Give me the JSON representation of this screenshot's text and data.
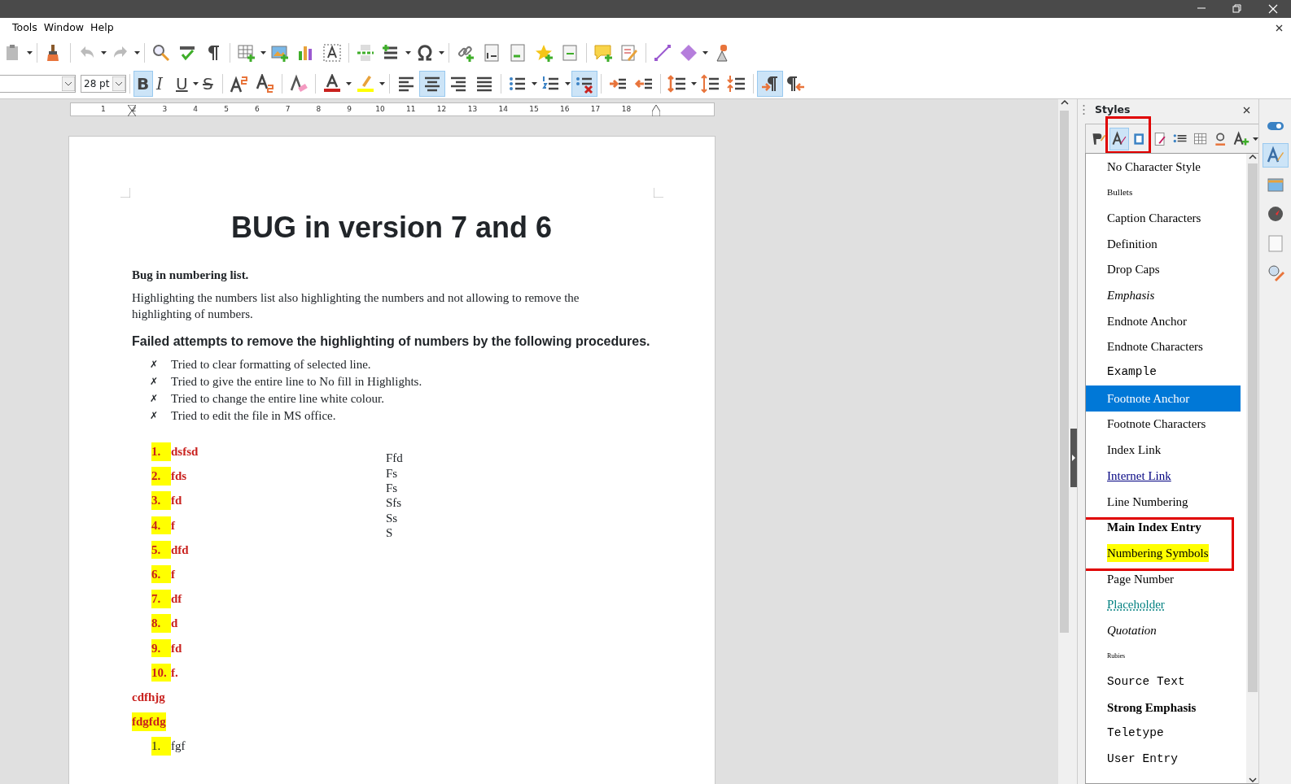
{
  "menu": [
    {
      "label": "Tools"
    },
    {
      "label": "Window"
    },
    {
      "label": "Help"
    }
  ],
  "formatting_toolbar": {
    "font_size": "28 pt",
    "toggles": [
      {
        "glyph": "B",
        "selected": true
      },
      {
        "glyph": "I",
        "selected": false
      },
      {
        "glyph": "U",
        "selected": false
      },
      {
        "glyph": "S",
        "selected": false
      }
    ],
    "alignment": [
      {
        "selected": false
      },
      {
        "selected": true
      },
      {
        "selected": false
      },
      {
        "selected": false
      }
    ],
    "lists": [
      {
        "selected": false
      },
      {
        "selected": false
      },
      {
        "selected": true
      }
    ],
    "direction": [
      {
        "selected": true
      },
      {
        "selected": false
      }
    ]
  },
  "ruler": {
    "numbers": [
      "1",
      "2",
      "3",
      "4",
      "5",
      "6",
      "7",
      "8",
      "9",
      "10",
      "11",
      "12",
      "13",
      "14",
      "15",
      "16",
      "17",
      "18"
    ]
  },
  "document": {
    "title": "BUG in version 7 and 6",
    "subtitle": "Bug in numbering list.",
    "paragraph": "Highlighting the numbers list also highlighting the numbers and not allowing to remove the highlighting of numbers.",
    "heading": "Failed attempts to remove the highlighting of numbers by the following procedures.",
    "bullets": [
      {
        "marker": "✗",
        "text": "Tried to clear formatting of selected line."
      },
      {
        "marker": "✗",
        "text": "Tried to give the entire line to No fill in Highlights."
      },
      {
        "marker": "✗",
        "text": "Tried to change the entire line white colour."
      },
      {
        "marker": "✗",
        "text": "Tried to edit the file in MS office."
      }
    ],
    "numbered": [
      {
        "number": "1.",
        "text": "dsfsd"
      },
      {
        "number": "2.",
        "text": "fds"
      },
      {
        "number": "3.",
        "text": "fd"
      },
      {
        "number": "4.",
        "text": "f"
      },
      {
        "number": "5.",
        "text": "dfd"
      },
      {
        "number": "6.",
        "text": "f"
      },
      {
        "number": "7.",
        "text": "df"
      },
      {
        "number": "8.",
        "text": "d"
      },
      {
        "number": "9.",
        "text": "fd"
      },
      {
        "number": "10.",
        "text": "f."
      }
    ],
    "frame_lines": [
      "Ffd",
      "Fs",
      "Fs",
      "Sfs",
      "Ss",
      "S"
    ],
    "after": [
      {
        "text": "cdfhjg",
        "highlighted": false
      },
      {
        "text": "fdgfdg",
        "highlighted": true
      }
    ],
    "second_list": [
      {
        "number": "1.",
        "text": "fgf"
      }
    ]
  },
  "sidebar": {
    "title": "Styles",
    "families": [
      {
        "selected": false
      },
      {
        "selected": true
      },
      {
        "selected": false
      },
      {
        "selected": false
      },
      {
        "selected": false
      },
      {
        "selected": false
      },
      {
        "selected": false
      },
      {
        "selected": false
      }
    ],
    "styles": [
      {
        "label": "No Character Style",
        "kind": "plain",
        "selected": false
      },
      {
        "label": "Bullets",
        "kind": "small",
        "selected": false
      },
      {
        "label": "Caption Characters",
        "kind": "plain",
        "selected": false
      },
      {
        "label": "Definition",
        "kind": "plain",
        "selected": false
      },
      {
        "label": "Drop Caps",
        "kind": "plain",
        "selected": false
      },
      {
        "label": "Emphasis",
        "kind": "italic",
        "selected": false
      },
      {
        "label": "Endnote Anchor",
        "kind": "plain",
        "selected": false
      },
      {
        "label": "Endnote Characters",
        "kind": "plain",
        "selected": false
      },
      {
        "label": "Example",
        "kind": "mono",
        "selected": false
      },
      {
        "label": "Footnote Anchor",
        "kind": "plain",
        "selected": true
      },
      {
        "label": "Footnote Characters",
        "kind": "plain",
        "selected": false
      },
      {
        "label": "Index Link",
        "kind": "plain",
        "selected": false
      },
      {
        "label": "Internet Link",
        "kind": "link",
        "selected": false
      },
      {
        "label": "Line Numbering",
        "kind": "plain",
        "selected": false
      },
      {
        "label": "Main Index Entry",
        "kind": "bold",
        "selected": false
      },
      {
        "label": "Numbering Symbols",
        "kind": "highlight",
        "selected": false
      },
      {
        "label": "Page Number",
        "kind": "plain",
        "selected": false
      },
      {
        "label": "Placeholder",
        "kind": "placeholder",
        "selected": false
      },
      {
        "label": "Quotation",
        "kind": "italic",
        "selected": false
      },
      {
        "label": "Rubies",
        "kind": "tiny",
        "selected": false
      },
      {
        "label": "Source Text",
        "kind": "mono",
        "selected": false
      },
      {
        "label": "Strong Emphasis",
        "kind": "bold",
        "selected": false
      },
      {
        "label": "Teletype",
        "kind": "mono",
        "selected": false
      },
      {
        "label": "User Entry",
        "kind": "mono",
        "selected": false
      }
    ],
    "tabs": [
      {
        "selected": false
      },
      {
        "selected": true
      },
      {
        "selected": false
      },
      {
        "selected": false
      },
      {
        "selected": false
      },
      {
        "selected": false
      }
    ]
  }
}
